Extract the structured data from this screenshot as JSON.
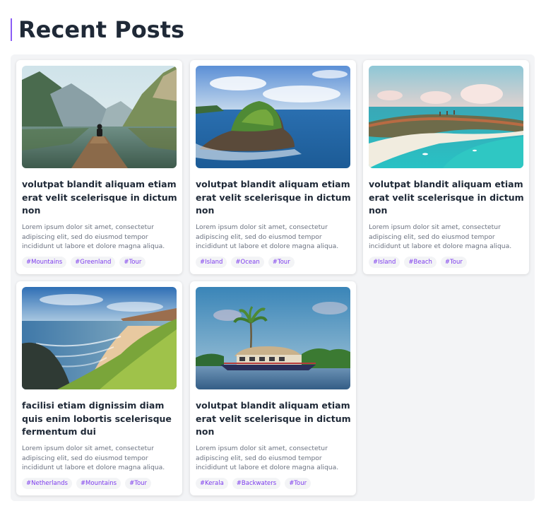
{
  "page_title": "Recent Posts",
  "colors": {
    "accent": "#8b5cf6",
    "tag_text": "#7c3aed",
    "tag_bg": "#f3f4f6",
    "panel_bg": "#f3f4f6"
  },
  "posts": [
    {
      "image": "mountain-lake-pier",
      "title": "volutpat blandit aliquam etiam erat velit scelerisque in dictum non",
      "excerpt": "Lorem ipsum dolor sit amet, consectetur adipiscing elit, sed do eiusmod tempor incididunt ut labore et dolore magna aliqua.",
      "tags": [
        "#Mountains",
        "#Greenland",
        "#Tour"
      ]
    },
    {
      "image": "rocky-island-ocean",
      "title": "volutpat blandit aliquam etiam erat velit scelerisque in dictum non",
      "excerpt": "Lorem ipsum dolor sit amet, consectetur adipiscing elit, sed do eiusmod tempor incididunt ut labore et dolore magna aliqua.",
      "tags": [
        "#Island",
        "#Ocean",
        "#Tour"
      ]
    },
    {
      "image": "tropical-lagoon-resort",
      "title": "volutpat blandit aliquam etiam erat velit scelerisque in dictum non",
      "excerpt": "Lorem ipsum dolor sit amet, consectetur adipiscing elit, sed do eiusmod tempor incididunt ut labore et dolore magna aliqua.",
      "tags": [
        "#Island",
        "#Beach",
        "#Tour"
      ]
    },
    {
      "image": "coastal-cliff-beach",
      "title": "facilisi etiam dignissim diam quis enim lobortis scelerisque fermentum dui",
      "excerpt": "Lorem ipsum dolor sit amet, consectetur adipiscing elit, sed do eiusmod tempor incididunt ut labore et dolore magna aliqua.",
      "tags": [
        "#Netherlands",
        "#Mountains",
        "#Tour"
      ]
    },
    {
      "image": "kerala-houseboat",
      "title": "volutpat blandit aliquam etiam erat velit scelerisque in dictum non",
      "excerpt": "Lorem ipsum dolor sit amet, consectetur adipiscing elit, sed do eiusmod tempor incididunt ut labore et dolore magna aliqua.",
      "tags": [
        "#Kerala",
        "#Backwaters",
        "#Tour"
      ]
    }
  ]
}
